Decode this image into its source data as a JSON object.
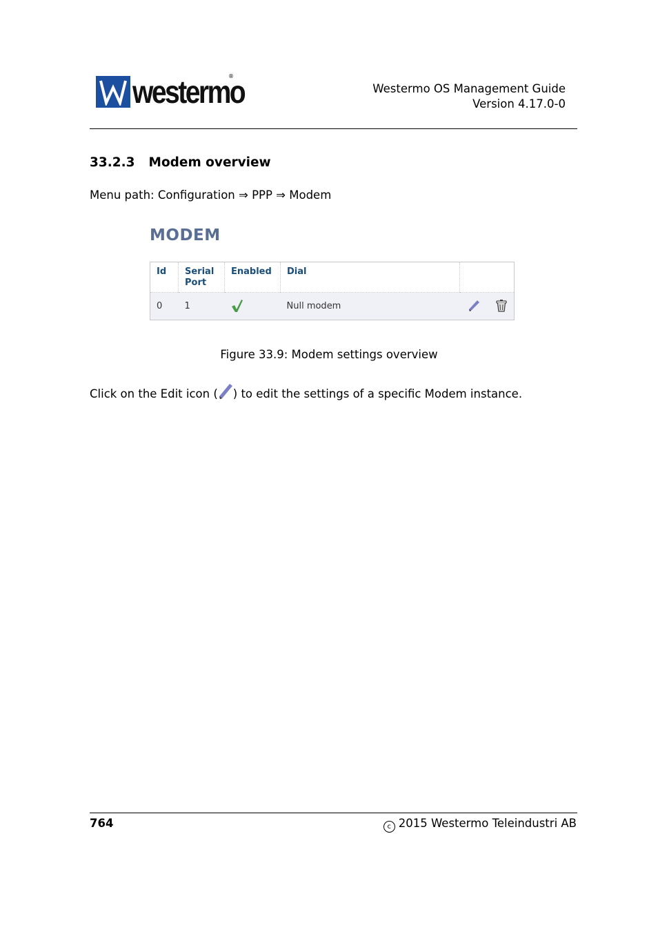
{
  "header": {
    "logo_text": "westermo",
    "logo_reg": "®",
    "doc_title": "Westermo OS Management Guide",
    "version": "Version 4.17.0-0"
  },
  "section": {
    "number": "33.2.3",
    "title": "Modem overview"
  },
  "menu_path": "Menu path: Configuration ⇒ PPP ⇒ Modem",
  "figure": {
    "title": "MODEM",
    "columns": [
      {
        "label_line1": "Id",
        "label_line2": ""
      },
      {
        "label_line1": "Serial",
        "label_line2": "Port"
      },
      {
        "label_line1": "Enabled",
        "label_line2": ""
      },
      {
        "label_line1": "Dial",
        "label_line2": ""
      },
      {
        "label_line1": "",
        "label_line2": ""
      }
    ],
    "rows": [
      {
        "id": "0",
        "serial_port": "1",
        "enabled": "check-icon",
        "dial": "Null modem",
        "actions": [
          "edit-icon",
          "delete-icon"
        ]
      }
    ],
    "caption": "Figure 33.9: Modem settings overview"
  },
  "body": {
    "before_icon": "Click on the Edit icon (",
    "after_icon": ") to edit the settings of a specific Modem instance."
  },
  "footer": {
    "page_number": "764",
    "copyright_symbol": "c",
    "copyright": "2015 Westermo Teleindustri AB"
  },
  "colors": {
    "logo_blue": "#1d4fa1",
    "title_slate": "#5a6e94",
    "header_text": "#1a4e7a",
    "check_green": "#4a9a4a",
    "pencil_purple": "#7b7fc4"
  }
}
